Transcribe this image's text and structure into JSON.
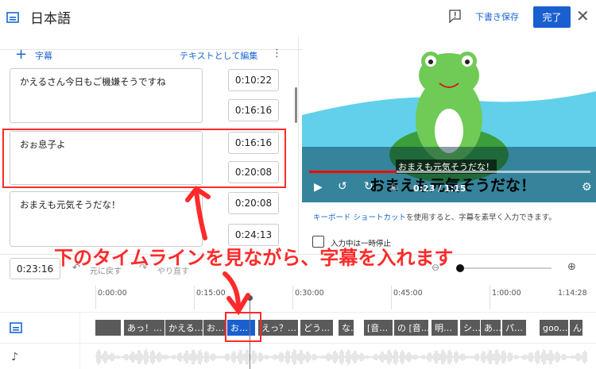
{
  "header": {
    "title": "日本語",
    "save_draft": "下書き保存",
    "done": "完了",
    "icons": [
      "subtitles-icon",
      "feedback-icon",
      "close-icon"
    ]
  },
  "editor": {
    "add_caption": "字幕",
    "edit_as_text": "テキストとして編集",
    "captions": [
      {
        "text": "かえるさん今日もご機嫌そうですね",
        "start": "0:10:22",
        "end": "0:16:16"
      },
      {
        "text": "おぉ息子よ",
        "start": "0:16:16",
        "end": "0:20:08"
      },
      {
        "text": "おまえも元気そうだな！",
        "start": "0:20:08",
        "end": "0:24:13"
      }
    ]
  },
  "video": {
    "caption_overlay": "おまえも元気そうだな！",
    "big_caption": "おまえも元気そうだな！",
    "time": "0:23 / 1:15",
    "progress": 0.31
  },
  "shortcut_hint": {
    "link": "キーボード ショートカット",
    "rest": "を使用すると、字幕を素早く入力できます。"
  },
  "pause_while_typing": {
    "label": "入力中は一時停止",
    "checked": false
  },
  "toolbar": {
    "current_time": "0:23:16",
    "undo": "元に戻す",
    "redo": "やり直す",
    "zoom_level": 0
  },
  "timeline": {
    "ticks": [
      "0:00:00",
      "0:15:00",
      "0:30:00",
      "0:45:00",
      "1:00:00",
      "1:14:28"
    ],
    "segments": [
      {
        "label": "",
        "active": false
      },
      {
        "label": "あっ！…",
        "active": false
      },
      {
        "label": "かえる…",
        "active": false
      },
      {
        "label": "お…",
        "active": false
      },
      {
        "label": "お…",
        "active": true
      },
      {
        "label": "えっ？…",
        "active": false
      },
      {
        "label": "どう…",
        "active": false
      },
      {
        "label": "な…",
        "active": false
      },
      {
        "label": "[音…",
        "active": false
      },
      {
        "label": "の [音…",
        "active": false
      },
      {
        "label": "明…",
        "active": false
      },
      {
        "label": "シ…",
        "active": false
      },
      {
        "label": "あ…",
        "active": false
      },
      {
        "label": "パ…",
        "active": false
      },
      {
        "label": "goo…",
        "active": false
      },
      {
        "label": "ん",
        "active": false
      }
    ]
  },
  "annotation": {
    "text": "下のタイムラインを見ながら、字幕を入れます",
    "color": "#ff2a2a"
  }
}
